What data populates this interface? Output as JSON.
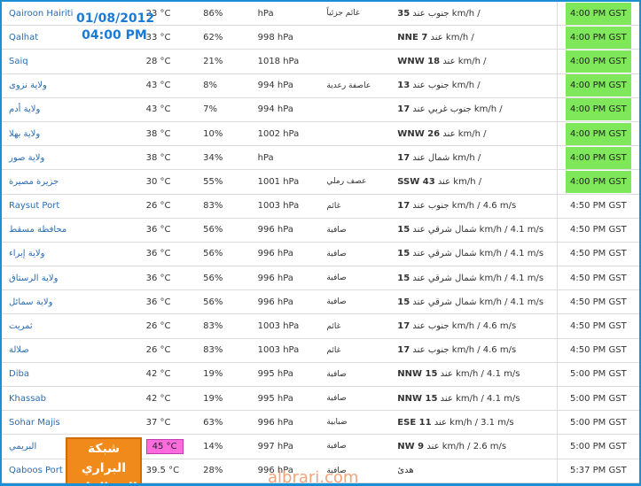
{
  "header_badge": {
    "date": "01/08/2012",
    "time": "04:00 PM"
  },
  "logo": {
    "line1": "شبكة البراري",
    "line2": "المد القادم"
  },
  "watermark": "albrari.com",
  "colors": {
    "frame": "#1a8fd6",
    "highlight_green": "#7ee85a",
    "highlight_pink": "#ff6bdf",
    "logo_orange": "#f08a1a",
    "link_blue": "#2a6cb3"
  },
  "rows": [
    {
      "name": "Qairoon Hairiti",
      "temp": "23 °C",
      "humidity": "86%",
      "pressure": "hPa",
      "condition": "غائم جزئياً",
      "wind_bold": "35",
      "wind_rest": " جنوب عند km/h /",
      "time": "4:00 PM GST"
    },
    {
      "name": "Qalhat",
      "temp": "33 °C",
      "humidity": "62%",
      "pressure": "998 hPa",
      "condition": "",
      "wind_bold": "NNE 7",
      "wind_rest": " عند km/h /",
      "time": "4:00 PM GST"
    },
    {
      "name": "Saiq",
      "temp": "28 °C",
      "humidity": "21%",
      "pressure": "1018 hPa",
      "condition": "",
      "wind_bold": "WNW 18",
      "wind_rest": " عند km/h /",
      "time": "4:00 PM GST"
    },
    {
      "name": "ولاية نزوى",
      "temp": "43 °C",
      "humidity": "8%",
      "pressure": "994 hPa",
      "condition": "عاصفة رعدية",
      "wind_bold": "13",
      "wind_rest": " جنوب عند km/h /",
      "time": "4:00 PM GST"
    },
    {
      "name": "ولاية أدم",
      "temp": "43 °C",
      "humidity": "7%",
      "pressure": "994 hPa",
      "condition": "",
      "wind_bold": "17",
      "wind_rest": " جنوب غربي عند km/h /",
      "time": "4:00 PM GST"
    },
    {
      "name": "ولاية بهلا",
      "temp": "38 °C",
      "humidity": "10%",
      "pressure": "1002 hPa",
      "condition": "",
      "wind_bold": "WNW 26",
      "wind_rest": " عند km/h /",
      "time": "4:00 PM GST"
    },
    {
      "name": "ولاية صور",
      "temp": "38 °C",
      "humidity": "34%",
      "pressure": "hPa",
      "condition": "",
      "wind_bold": "17",
      "wind_rest": " شمال عند km/h /",
      "time": "4:00 PM GST"
    },
    {
      "name": "جزيرة مصيرة",
      "temp": "30 °C",
      "humidity": "55%",
      "pressure": "1001 hPa",
      "condition": "عصف رملي",
      "wind_bold": "SSW 43",
      "wind_rest": " عند km/h /",
      "time": "4:00 PM GST"
    },
    {
      "name": "Raysut Port",
      "temp": "26 °C",
      "humidity": "83%",
      "pressure": "1003 hPa",
      "condition": "غائم",
      "wind_bold": "17",
      "wind_rest": " جنوب عند km/h / 4.6 m/s",
      "time": "4:50 PM GST"
    },
    {
      "name": "محافظة مسقط",
      "temp": "36 °C",
      "humidity": "56%",
      "pressure": "996 hPa",
      "condition": "صافية",
      "wind_bold": "15",
      "wind_rest": " شمال شرقي عند km/h / 4.1 m/s",
      "time": "4:50 PM GST"
    },
    {
      "name": "ولاية إبراء",
      "temp": "36 °C",
      "humidity": "56%",
      "pressure": "996 hPa",
      "condition": "صافية",
      "wind_bold": "15",
      "wind_rest": " شمال شرقي عند km/h / 4.1 m/s",
      "time": "4:50 PM GST"
    },
    {
      "name": "ولاية الرستاق",
      "temp": "36 °C",
      "humidity": "56%",
      "pressure": "996 hPa",
      "condition": "صافية",
      "wind_bold": "15",
      "wind_rest": " شمال شرقي عند km/h / 4.1 m/s",
      "time": "4:50 PM GST"
    },
    {
      "name": "ولاية سمائل",
      "temp": "36 °C",
      "humidity": "56%",
      "pressure": "996 hPa",
      "condition": "صافية",
      "wind_bold": "15",
      "wind_rest": " شمال شرقي عند km/h / 4.1 m/s",
      "time": "4:50 PM GST"
    },
    {
      "name": "ثمريت",
      "temp": "26 °C",
      "humidity": "83%",
      "pressure": "1003 hPa",
      "condition": "غائم",
      "wind_bold": "17",
      "wind_rest": " جنوب عند km/h / 4.6 m/s",
      "time": "4:50 PM GST"
    },
    {
      "name": "صلالة",
      "temp": "26 °C",
      "humidity": "83%",
      "pressure": "1003 hPa",
      "condition": "غائم",
      "wind_bold": "17",
      "wind_rest": " جنوب عند km/h / 4.6 m/s",
      "time": "4:50 PM GST"
    },
    {
      "name": "Diba",
      "temp": "42 °C",
      "humidity": "19%",
      "pressure": "995 hPa",
      "condition": "صافية",
      "wind_bold": "NNW 15",
      "wind_rest": " عند km/h / 4.1 m/s",
      "time": "5:00 PM GST"
    },
    {
      "name": "Khassab",
      "temp": "42 °C",
      "humidity": "19%",
      "pressure": "995 hPa",
      "condition": "صافية",
      "wind_bold": "NNW 15",
      "wind_rest": " عند km/h / 4.1 m/s",
      "time": "5:00 PM GST"
    },
    {
      "name": "Sohar Majis",
      "temp": "37 °C",
      "humidity": "63%",
      "pressure": "996 hPa",
      "condition": "ضبابية",
      "wind_bold": "ESE 11",
      "wind_rest": " عند km/h / 3.1 m/s",
      "time": "5:00 PM GST"
    },
    {
      "name": "البريمي",
      "temp": "45 °C",
      "humidity": "14%",
      "pressure": "997 hPa",
      "condition": "صافية",
      "wind_bold": "NW 9",
      "wind_rest": " عند km/h / 2.6 m/s",
      "time": "5:00 PM GST"
    },
    {
      "name": "Qaboos Port",
      "temp": "39.5 °C",
      "humidity": "28%",
      "pressure": "996 hPa",
      "condition": "صافية",
      "wind_bold": "",
      "wind_rest": "هدئ",
      "time": "5:37 PM GST"
    }
  ]
}
